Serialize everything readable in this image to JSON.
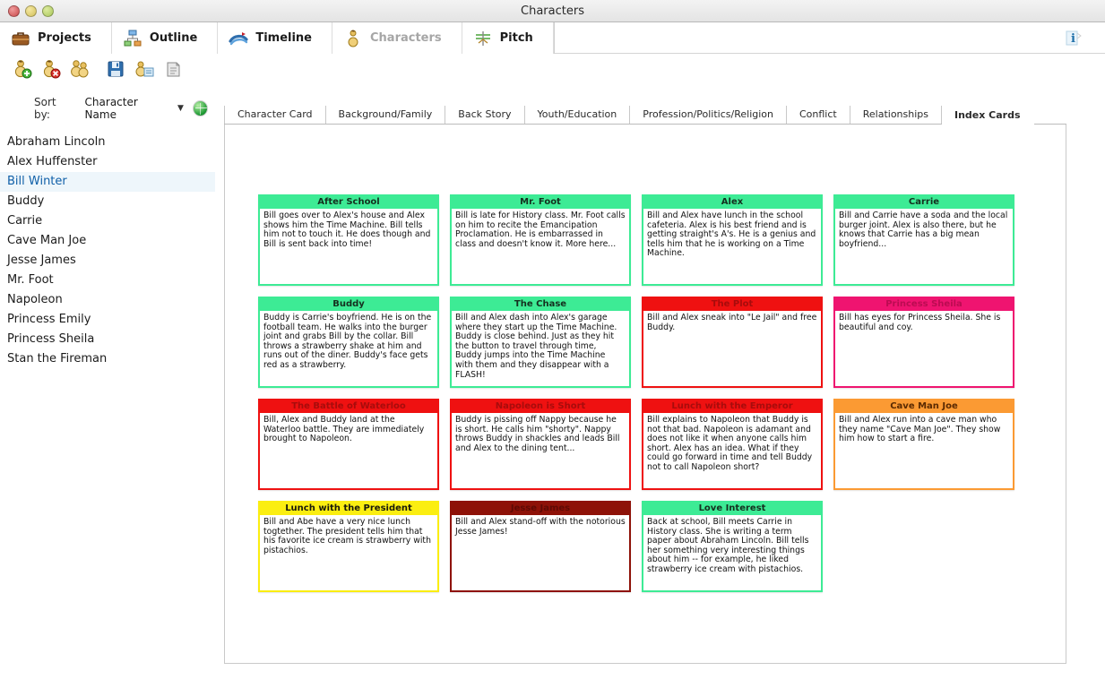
{
  "window": {
    "title": "Characters",
    "controls": [
      "close-button",
      "minimize-button",
      "maximize-button"
    ]
  },
  "modules": [
    {
      "label": "Projects",
      "icon": "briefcase-icon",
      "active": false,
      "dim": false
    },
    {
      "label": "Outline",
      "icon": "outline-icon",
      "active": false,
      "dim": false
    },
    {
      "label": "Timeline",
      "icon": "timeline-icon",
      "active": false,
      "dim": false
    },
    {
      "label": "Characters",
      "icon": "characters-icon",
      "active": true,
      "dim": true
    },
    {
      "label": "Pitch",
      "icon": "pitch-icon",
      "active": false,
      "dim": false
    }
  ],
  "info_button": {
    "name": "info-button",
    "glyph": "i"
  },
  "toolbar": {
    "buttons": [
      {
        "name": "add-character-button",
        "icon": "character-add-icon"
      },
      {
        "name": "delete-character-button",
        "icon": "character-delete-icon"
      },
      {
        "name": "duplicate-character-button",
        "icon": "character-duplicate-icon"
      },
      {
        "name": "save-button",
        "icon": "floppy-disk-icon"
      },
      {
        "name": "character-report-button",
        "icon": "character-report-icon"
      },
      {
        "name": "print-button",
        "icon": "print-icon"
      }
    ]
  },
  "sidebar": {
    "sort_label": "Sort by:",
    "sort_value": "Character Name",
    "add_button_icon": "green-globe-icon",
    "selected": "Bill Winter",
    "characters": [
      "Abraham Lincoln",
      "Alex Huffenster",
      "Bill Winter",
      "Buddy",
      "Carrie",
      "Cave Man Joe",
      "Jesse James",
      "Mr. Foot",
      "Napoleon",
      "Princess Emily",
      "Princess Sheila",
      "Stan the Fireman"
    ]
  },
  "tabs": [
    {
      "label": "Character Card",
      "active": false
    },
    {
      "label": "Background/Family",
      "active": false
    },
    {
      "label": "Back Story",
      "active": false
    },
    {
      "label": "Youth/Education",
      "active": false
    },
    {
      "label": "Profession/Politics/Religion",
      "active": false
    },
    {
      "label": "Conflict",
      "active": false
    },
    {
      "label": "Relationships",
      "active": false
    },
    {
      "label": "Index Cards",
      "active": true
    }
  ],
  "colors": {
    "green": "#3deb95",
    "red": "#ef1111",
    "pink": "#ef1470",
    "orange": "#fb9a33",
    "yellow": "#fbee11",
    "darkred": "#8e1208",
    "header_text_dark": "#15301f",
    "header_text_red": "#a80c0c",
    "header_text_pink": "#bb0c52",
    "header_text_darkred": "#5e0a04"
  },
  "cards": [
    {
      "title": "After School",
      "color": "#3deb95",
      "title_color": "#15301f",
      "text": "Bill goes over to Alex's house and Alex shows him the Time Machine. Bill tells him not to touch it. He does though and Bill is sent back into time!"
    },
    {
      "title": "Mr. Foot",
      "color": "#3deb95",
      "title_color": "#15301f",
      "text": "Bill is late for History class. Mr. Foot calls on him to recite the Emancipation Proclamation. He is embarrassed in class and doesn't know it. More here..."
    },
    {
      "title": "Alex",
      "color": "#3deb95",
      "title_color": "#15301f",
      "text": "Bill and Alex have lunch in the school cafeteria. Alex is his best friend and is getting straight's A's. He is a genius and tells him that he is working on a Time Machine."
    },
    {
      "title": "Carrie",
      "color": "#3deb95",
      "title_color": "#15301f",
      "text": "Bill and Carrie have a soda and the local burger joint. Alex is also there, but he knows that Carrie has a big mean boyfriend..."
    },
    {
      "title": "Buddy",
      "color": "#3deb95",
      "title_color": "#15301f",
      "text": "Buddy is Carrie's boyfriend. He is on the football team. He walks into the burger joint and grabs Bill by the collar. Bill throws a strawberry shake at him and runs out of the diner. Buddy's face gets red as a strawberry."
    },
    {
      "title": "The Chase",
      "color": "#3deb95",
      "title_color": "#15301f",
      "text": "Bill and Alex dash into Alex's garage where they start up the Time Machine. Buddy is close behind. Just as they hit the button to travel through time, Buddy jumps into the Time Machine with them and they disappear with a FLASH!"
    },
    {
      "title": "The Plot",
      "color": "#ef1111",
      "title_color": "#a80c0c",
      "text": "Bill and Alex sneak into \"Le Jail\" and free Buddy."
    },
    {
      "title": "Princess Sheila",
      "color": "#ef1470",
      "title_color": "#bb0c52",
      "text": "Bill has eyes for Princess Sheila. She is beautiful and coy."
    },
    {
      "title": "The Battle of Waterloo",
      "color": "#ef1111",
      "title_color": "#a80c0c",
      "text": "Bill, Alex and Buddy land at the Waterloo battle. They are immediately brought to Napoleon."
    },
    {
      "title": "Napoleon is Short",
      "color": "#ef1111",
      "title_color": "#a80c0c",
      "text": "Buddy is pissing off Nappy because he is short. He calls him \"shorty\". Nappy throws Buddy in shackles and leads Bill and Alex to the dining tent..."
    },
    {
      "title": "Lunch with the Emperor",
      "color": "#ef1111",
      "title_color": "#a80c0c",
      "text": "Bill explains to Napoleon that Buddy is not that bad. Napoleon is adamant and does not like it when anyone calls him short. Alex has an idea. What if they could go forward in time and tell Buddy not to call Napoleon short?"
    },
    {
      "title": "Cave Man Joe",
      "color": "#fb9a33",
      "title_color": "#5a2a02",
      "text": "Bill and Alex run into a cave man who they name \"Cave Man Joe\". They show him how to start a fire."
    },
    {
      "title": "Lunch with the President",
      "color": "#fbee11",
      "title_color": "#1a1a0a",
      "text": "Bill and Abe have a very nice lunch togtether. The president tells him that his favorite ice cream is strawberry with pistachios."
    },
    {
      "title": "Jesse James",
      "color": "#8e1208",
      "title_color": "#5e0a04",
      "text": "Bill and Alex stand-off with the notorious Jesse James!"
    },
    {
      "title": "Love Interest",
      "color": "#3deb95",
      "title_color": "#15301f",
      "text": "Back at school, Bill meets Carrie in History class. She is writing a term paper about Abraham Lincoln. Bill tells her something very interesting things about him -- for example, he liked strawberry ice cream with pistachios."
    }
  ]
}
